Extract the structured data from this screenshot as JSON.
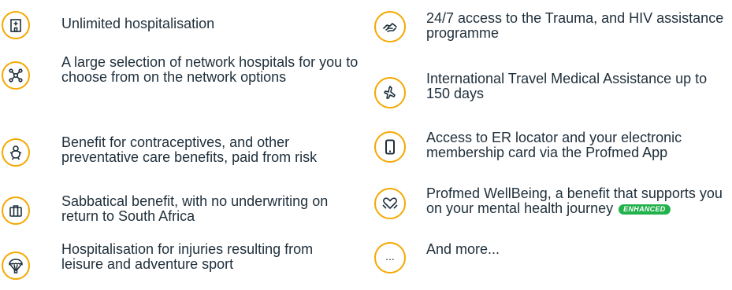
{
  "left_items": [
    {
      "icon": "hospital-building-icon",
      "text": "Unlimited hospitalisation"
    },
    {
      "icon": "network-nodes-icon",
      "text": "A large selection of network hospitals for you to choose from on the network options"
    },
    {
      "icon": "baby-icon",
      "text": "Benefit for contraceptives, and other preventative care benefits, paid from risk"
    },
    {
      "icon": "briefcase-icon",
      "text": "Sabbatical benefit, with no underwriting on return to South Africa"
    },
    {
      "icon": "parachute-icon",
      "text": "Hospitalisation for injuries resulting from leisure and adventure sport"
    }
  ],
  "right_items": [
    {
      "icon": "helping-hand-icon",
      "text": "24/7 access to the Trauma, and HIV assistance programme"
    },
    {
      "icon": "airplane-icon",
      "text": "International Travel Medical Assistance up to 150 days"
    },
    {
      "icon": "smartphone-icon",
      "text": "Access to ER locator and your electronic membership card via the Profmed App"
    },
    {
      "icon": "heart-hands-icon",
      "text": "Profmed WellBeing, a benefit that supports you on your mental health journey",
      "badge": "ENHANCED"
    },
    {
      "icon": "ellipsis-icon",
      "icon_text": "...",
      "text": "And more..."
    }
  ],
  "colors": {
    "accent": "#f5a800",
    "text": "#1f2f3b",
    "badge": "#22b24c"
  }
}
